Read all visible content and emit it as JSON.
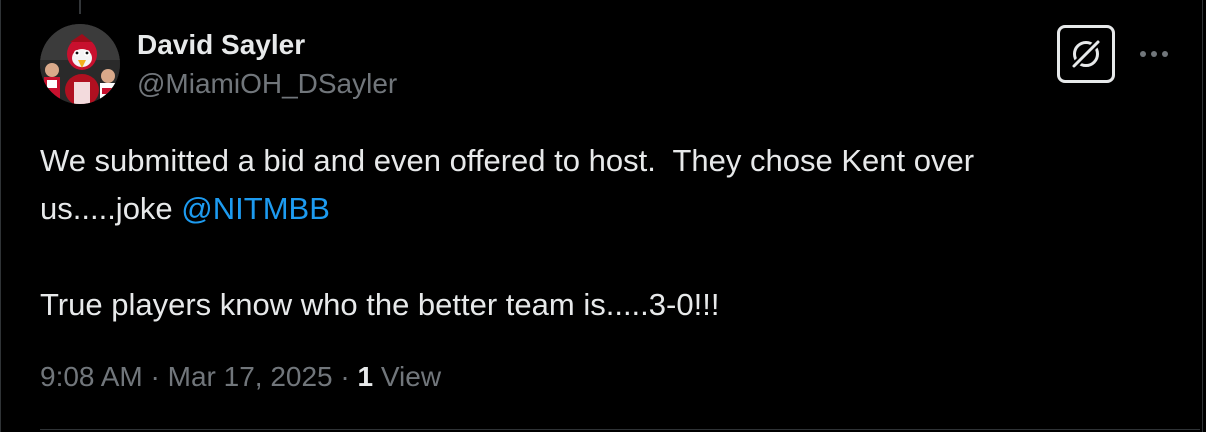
{
  "author": {
    "display_name": "David Sayler",
    "handle": "@MiamiOH_DSayler",
    "avatar_icon": "mascot-photo-avatar"
  },
  "tweet": {
    "line1": "We submitted a bid and even offered to host.  They chose Kent over",
    "line2_prefix": "us.....joke ",
    "mention": "@NITMBB",
    "line4": "True players know who the better team is.....3-0!!!"
  },
  "meta": {
    "time": "9:08 AM",
    "separator1": " · ",
    "date": "Mar 17, 2025",
    "separator2": " · ",
    "views_count": "1",
    "views_label": " View"
  },
  "actions": {
    "grok_icon": "grok-icon",
    "more_icon": "more-options-icon"
  },
  "colors": {
    "background": "#000000",
    "text_primary": "#e7e9ea",
    "text_secondary": "#71767b",
    "link": "#1d9bf0",
    "border": "#2f3336"
  }
}
